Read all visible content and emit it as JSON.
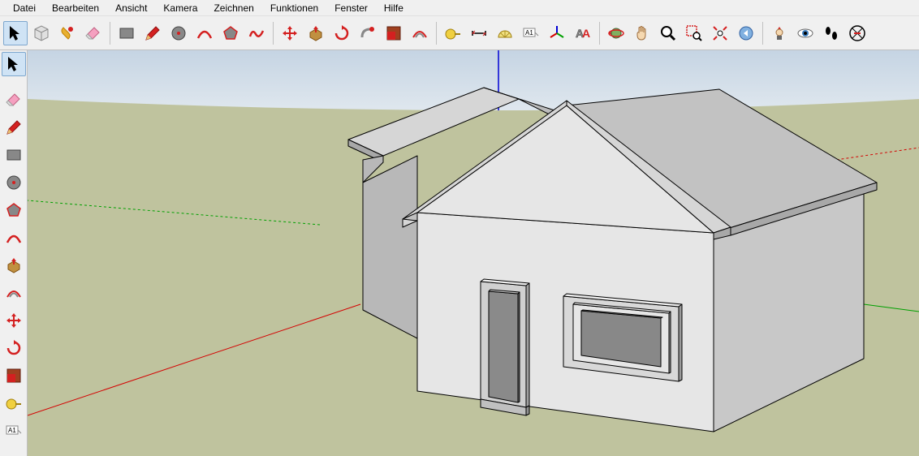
{
  "menubar": {
    "items": [
      "Datei",
      "Bearbeiten",
      "Ansicht",
      "Kamera",
      "Zeichnen",
      "Funktionen",
      "Fenster",
      "Hilfe"
    ]
  },
  "toolbar_top": {
    "groups": [
      {
        "items": [
          {
            "name": "select-tool",
            "icon": "arrow",
            "selected": true
          },
          {
            "name": "make-component-tool",
            "icon": "component"
          },
          {
            "name": "paint-bucket-tool",
            "icon": "paint"
          },
          {
            "name": "eraser-tool",
            "icon": "eraser"
          }
        ]
      },
      {
        "items": [
          {
            "name": "rectangle-tool",
            "icon": "rect"
          },
          {
            "name": "line-tool",
            "icon": "pencil"
          },
          {
            "name": "circle-tool",
            "icon": "circle"
          },
          {
            "name": "arc-tool",
            "icon": "arc"
          },
          {
            "name": "polygon-tool",
            "icon": "polygon"
          },
          {
            "name": "freehand-tool",
            "icon": "freehand"
          }
        ]
      },
      {
        "items": [
          {
            "name": "move-tool",
            "icon": "move"
          },
          {
            "name": "push-pull-tool",
            "icon": "pushpull"
          },
          {
            "name": "rotate-tool",
            "icon": "rotate"
          },
          {
            "name": "follow-me-tool",
            "icon": "followme"
          },
          {
            "name": "scale-tool",
            "icon": "scale"
          },
          {
            "name": "offset-tool",
            "icon": "offset"
          }
        ]
      },
      {
        "items": [
          {
            "name": "tape-measure-tool",
            "icon": "tape"
          },
          {
            "name": "dimensions-tool",
            "icon": "dimension"
          },
          {
            "name": "protractor-tool",
            "icon": "protractor"
          },
          {
            "name": "text-tool",
            "icon": "text"
          },
          {
            "name": "axes-tool",
            "icon": "axes"
          },
          {
            "name": "3d-text-tool",
            "icon": "3dtext"
          }
        ]
      },
      {
        "items": [
          {
            "name": "orbit-tool",
            "icon": "orbit"
          },
          {
            "name": "pan-tool",
            "icon": "pan"
          },
          {
            "name": "zoom-tool",
            "icon": "zoom"
          },
          {
            "name": "zoom-window-tool",
            "icon": "zoomwindow"
          },
          {
            "name": "zoom-extents-tool",
            "icon": "zoomextents"
          },
          {
            "name": "previous-tool",
            "icon": "previous"
          }
        ]
      },
      {
        "items": [
          {
            "name": "position-camera-tool",
            "icon": "camera"
          },
          {
            "name": "look-around-tool",
            "icon": "look"
          },
          {
            "name": "walk-tool",
            "icon": "walk"
          },
          {
            "name": "section-plane-tool",
            "icon": "section"
          }
        ]
      }
    ]
  },
  "toolbar_side": {
    "select": {
      "name": "select-tool",
      "icon": "arrow",
      "selected": true
    },
    "items": [
      {
        "name": "eraser-tool",
        "icon": "eraser"
      },
      {
        "name": "line-tool",
        "icon": "pencil"
      },
      {
        "name": "rectangle-tool",
        "icon": "rect"
      },
      {
        "name": "circle-tool",
        "icon": "circle"
      },
      {
        "name": "polygon-tool",
        "icon": "polygon"
      },
      {
        "name": "arc-tool",
        "icon": "arc"
      },
      {
        "name": "push-pull-tool",
        "icon": "pushpull"
      },
      {
        "name": "offset-tool",
        "icon": "offset"
      },
      {
        "name": "move-tool",
        "icon": "move"
      },
      {
        "name": "rotate-tool",
        "icon": "rotate"
      },
      {
        "name": "scale-tool",
        "icon": "scale"
      },
      {
        "name": "tape-measure-tool",
        "icon": "tape"
      },
      {
        "name": "text-tool",
        "icon": "text"
      }
    ]
  },
  "scene": {
    "axes": {
      "x": "#d40000",
      "y": "#00a000",
      "z": "#0000d4"
    },
    "ground": "#bfc39e",
    "sky_top": "#c5d4e3",
    "sky_bottom": "#dfe7ee",
    "model": "house"
  },
  "icons": {
    "arrow": "<path d='M4 2 L4 18 L8 14 L11 20 L14 18 L11 12 L16 12 Z' fill='#000'/>",
    "component": "<path d='M3 6 L11 2 L19 6 L19 16 L11 20 L3 16 Z' fill='#e0e0e0' stroke='#888'/><path d='M3 6 L11 10 L19 6 M11 10 L11 20' fill='none' stroke='#888'/>",
    "paint": "<path d='M6 4 Q2 8 6 12 L12 18 Q16 14 12 10 Z' fill='#e8b030' stroke='#c08000'/><circle cx='15' cy='6' r='3' fill='#d42020'/>",
    "eraser": "<path d='M4 12 L12 4 L18 10 L10 18 L4 12 Z' fill='#f5a0c0' stroke='#c06080'/><path d='M4 12 L10 18 L6 18 L2 14 Z' fill='#e0e0e0' stroke='#a0a0a0'/>",
    "rect": "<rect x='3' y='5' width='16' height='12' fill='#888' stroke='#444'/>",
    "pencil": "<path d='M3 19 L5 13 L15 3 L19 7 L9 17 Z' fill='#d42020' stroke='#901010'/><path d='M3 19 L5 13 L9 17 Z' fill='#e8c070'/>",
    "circle": "<circle cx='11' cy='11' r='8' fill='#888' stroke='#444'/><circle cx='11' cy='11' r='2' fill='#d42020'/>",
    "arc": "<path d='M3 17 Q11 1 19 17' fill='none' stroke='#d42020' stroke-width='2.5'/>",
    "polygon": "<path d='M11 3 L19 9 L16 18 L6 18 L3 9 Z' fill='#888' stroke='#d42020' stroke-width='1.5'/>",
    "freehand": "<path d='M3 15 Q6 5 10 12 T19 8' fill='none' stroke='#d42020' stroke-width='2.5'/>",
    "move": "<path d='M11 2 L14 6 L12 6 L12 10 L16 10 L16 8 L20 11 L16 14 L16 12 L12 12 L12 16 L14 16 L11 20 L8 16 L10 16 L10 12 L6 12 L6 14 L2 11 L6 8 L6 10 L10 10 L10 6 L8 6 Z' fill='#d42020'/>",
    "pushpull": "<path d='M4 10 L11 6 L18 10 L18 16 L11 20 L4 16 Z' fill='#c09040' stroke='#805010'/><path d='M11 2 L14 6 L12 6 L12 10 L10 10 L10 6 L8 6 Z' fill='#d42020'/>",
    "rotate": "<path d='M11 4 A7 7 0 1 1 4 11' fill='none' stroke='#d42020' stroke-width='2.5'/><path d='M11 1 L15 4 L11 7 Z' fill='#d42020'/>",
    "followme": "<path d='M4 16 Q4 6 14 6' fill='none' stroke='#888' stroke-width='3'/><circle cx='16' cy='6' r='3' fill='#d42020'/>",
    "scale": "<rect x='3' y='3' width='16' height='16' fill='#a04020' stroke='#602010'/><rect x='3' y='9' width='10' height='10' fill='#d42020'/>",
    "offset": "<path d='M3 16 Q11 2 19 16' fill='none' stroke='#d42020' stroke-width='2'/><path d='M6 16 Q11 7 16 16' fill='none' stroke='#888' stroke-width='2'/>",
    "tape": "<circle cx='8' cy='12' r='6' fill='#f0d040' stroke='#a08010'/><rect x='13' y='11' width='7' height='2' fill='#a08010'/>",
    "dimension": "<path d='M3 11 L19 11 M3 8 L3 14 M19 8 L19 14' stroke='#000' stroke-width='1.5'/><path d='M6 11 L3 11 L6 8 M16 11 L19 11 L16 14' fill='none' stroke='#d42020'/>",
    "protractor": "<path d='M3 16 A8 8 0 0 1 19 16 Z' fill='#f0e080' stroke='#a08010'/><path d='M11 16 L11 8 M11 16 L5 10 M11 16 L17 10' stroke='#a08010' stroke-width='0.8'/>",
    "text": "<rect x='2' y='5' width='14' height='10' fill='#fff' stroke='#888'/><text x='4' y='13' font-size='8' fill='#000'>A1</text><path d='M16 10 L20 14' stroke='#888'/>",
    "axes": "<path d='M11 11 L11 2' stroke='#0000d4' stroke-width='2'/><path d='M11 11 L3 16' stroke='#d40000' stroke-width='2'/><path d='M11 11 L19 16' stroke='#00a000' stroke-width='2'/>",
    "3dtext": "<text x='2' y='16' font-size='14' font-weight='bold' fill='#888' stroke='#444' stroke-width='0.5'>A</text><text x='10' y='16' font-size='14' font-weight='bold' fill='#d42020'>A</text>",
    "orbit": "<circle cx='11' cy='11' r='6' fill='#80b060' stroke='#406030'/><ellipse cx='11' cy='11' rx='9' ry='4' fill='none' stroke='#d42020' stroke-width='1.5'/><path d='M2 11 L4 8 L5 13 Z' fill='#d42020'/>",
    "pan": "<path d='M7 10 L7 4 Q8 3 9 4 L9 9 L9 3 Q10 2 11 3 L11 9 L11 4 Q12 3 13 4 L13 10 L13 6 Q14 5 15 6 L15 13 Q15 19 10 19 Q5 19 5 13 L5 11 Q6 9 7 10 Z' fill='#f5d8b0' stroke='#a07040'/>",
    "zoom": "<circle cx='9' cy='9' r='6' fill='#ffffff' stroke='#000' stroke-width='2'/><path d='M14 14 L19 19' stroke='#000' stroke-width='3'/>",
    "zoomwindow": "<rect x='2' y='2' width='12' height='12' fill='none' stroke='#d42020' stroke-width='1.5' stroke-dasharray='2 1'/><circle cx='14' cy='14' r='4' fill='#fff' stroke='#000' stroke-width='1.5'/><path d='M17 17 L20 20' stroke='#000' stroke-width='2'/>",
    "zoomextents": "<path d='M3 3 L7 7 M19 3 L15 7 M3 19 L7 15 M19 19 L15 15' stroke='#d42020' stroke-width='2'/><circle cx='11' cy='11' r='3' fill='#fff' stroke='#000'/>",
    "previous": "<circle cx='11' cy='11' r='8' fill='#80b0e0' stroke='#3060a0'/><path d='M8 11 L13 7 L13 15 Z' fill='#fff'/>",
    "camera": "<path d='M11 3 L13 6 L9 6 Z' fill='#d42020'/><circle cx='11' cy='10' r='4' fill='#f5d8b0' stroke='#a07040'/><rect x='8' y='14' width='6' height='5' fill='#666'/>",
    "look": "<ellipse cx='11' cy='11' rx='9' ry='5' fill='#fff' stroke='#666'/><circle cx='11' cy='11' r='4' fill='#4080c0'/><circle cx='11' cy='11' r='2' fill='#000'/>",
    "walk": "<ellipse cx='7' cy='8' rx='3' ry='5' fill='#000'/><ellipse cx='15' cy='14' rx='3' ry='5' fill='#000'/>",
    "section": "<circle cx='11' cy='11' r='9' fill='none' stroke='#000' stroke-width='1.5'/><path d='M5 5 L17 17 M5 17 L17 5' stroke='#000'/><path d='M7 11 L15 11' stroke='#d42020' stroke-width='2'/>"
  }
}
